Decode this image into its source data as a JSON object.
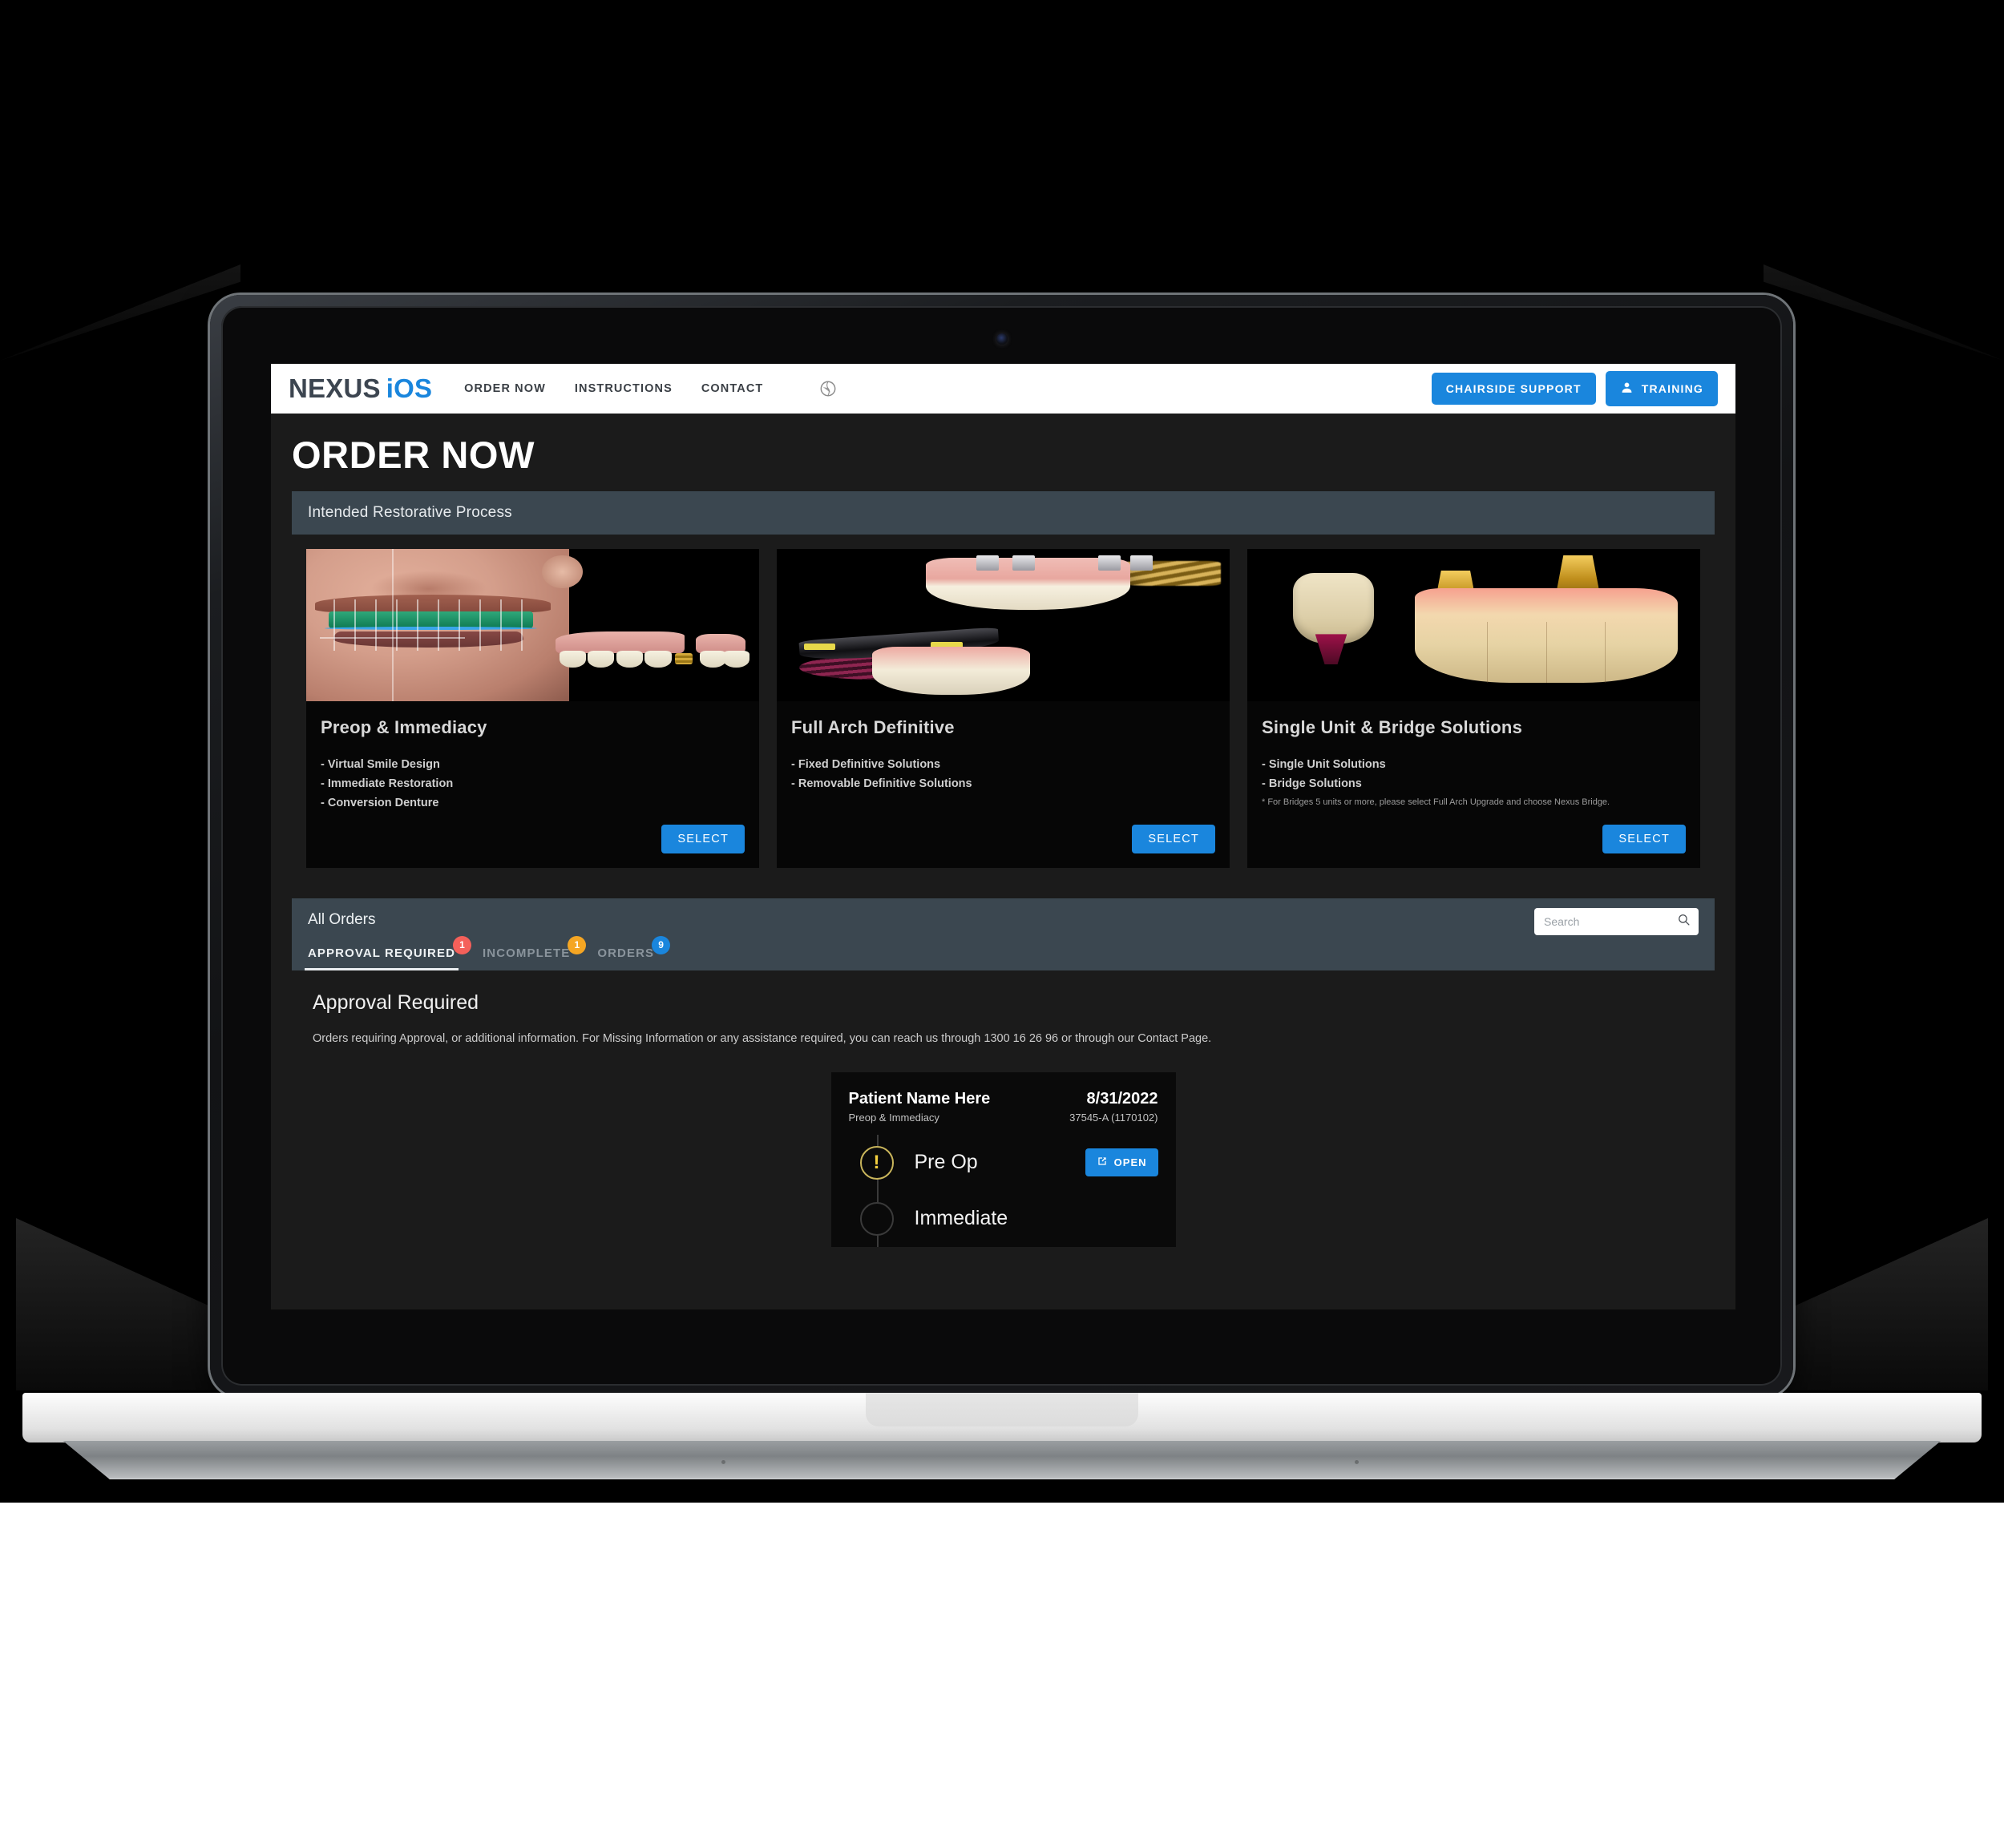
{
  "navbar": {
    "logo_primary": "NEXUS",
    "logo_secondary": "iOS",
    "links": [
      {
        "label": "ORDER NOW"
      },
      {
        "label": "INSTRUCTIONS"
      },
      {
        "label": "CONTACT"
      }
    ],
    "globe_icon": "globe-icon",
    "chairside_support_label": "CHAIRSIDE SUPPORT",
    "training_label": "TRAINING",
    "training_icon": "person-icon",
    "accent_color": "#1a86dd"
  },
  "page": {
    "title": "ORDER NOW",
    "background_color": "#1b1b1b"
  },
  "restorative_panel": {
    "header": "Intended Restorative Process",
    "header_color": "#3b4750",
    "cards": [
      {
        "title": "Preop & Immediacy",
        "bullets": [
          "- Virtual Smile Design",
          "- Immediate Restoration",
          "- Conversion Denture"
        ],
        "note": "",
        "select_label": "SELECT",
        "image_alt": "virtual-smile-design-photo"
      },
      {
        "title": "Full Arch Definitive",
        "bullets": [
          "- Fixed Definitive Solutions",
          "- Removable Definitive Solutions"
        ],
        "note": "",
        "select_label": "SELECT",
        "image_alt": "full-arch-definitive-photo"
      },
      {
        "title": "Single Unit & Bridge Solutions",
        "bullets": [
          "- Single Unit Solutions",
          "- Bridge Solutions"
        ],
        "note": "* For Bridges 5 units or more, please select Full Arch Upgrade and choose Nexus Bridge.",
        "select_label": "SELECT",
        "image_alt": "single-unit-bridge-photo"
      }
    ]
  },
  "orders_panel": {
    "title": "All Orders",
    "search": {
      "placeholder": "Search",
      "value": "",
      "icon": "search-icon"
    },
    "tabs": [
      {
        "label": "APPROVAL REQUIRED",
        "badge": "1",
        "badge_color": "#f4605a",
        "active": true
      },
      {
        "label": "INCOMPLETE",
        "badge": "1",
        "badge_color": "#f5a623",
        "active": false
      },
      {
        "label": "ORDERS",
        "badge": "9",
        "badge_color": "#1a86dd",
        "active": false
      }
    ],
    "content": {
      "heading": "Approval Required",
      "description": "Orders requiring Approval, or additional information. For Missing Information or any assistance required, you can reach us through 1300 16 26 96 or through our Contact Page."
    },
    "order_card": {
      "patient_name": "Patient Name Here",
      "process": "Preop & Immediacy",
      "date": "8/31/2022",
      "code": "37545-A (1170102)",
      "steps": [
        {
          "label": "Pre Op",
          "status_icon": "warning-icon",
          "status": "attention",
          "action_label": "OPEN",
          "action_icon": "external-link-icon"
        },
        {
          "label": "Immediate",
          "status_icon": "circle-icon",
          "status": "pending",
          "action_label": "",
          "action_icon": ""
        }
      ]
    }
  }
}
